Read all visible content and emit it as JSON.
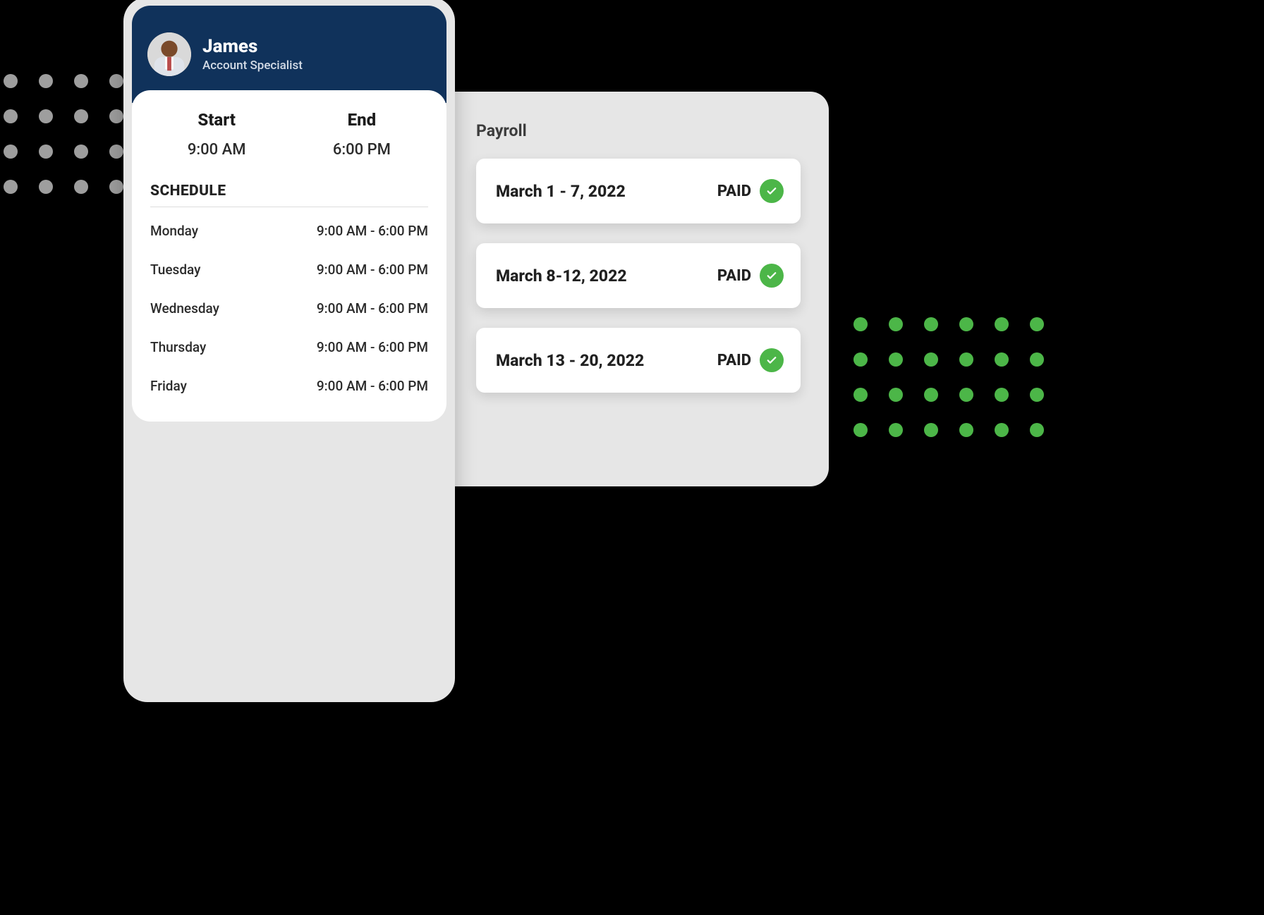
{
  "employee": {
    "name": "James",
    "role": "Account Specialist"
  },
  "times": {
    "start_label": "Start",
    "end_label": "End",
    "start_value": "9:00 AM",
    "end_value": "6:00 PM"
  },
  "schedule": {
    "title": "SCHEDULE",
    "rows": [
      {
        "day": "Monday",
        "hours": "9:00 AM - 6:00 PM"
      },
      {
        "day": "Tuesday",
        "hours": "9:00 AM - 6:00 PM"
      },
      {
        "day": "Wednesday",
        "hours": "9:00 AM - 6:00 PM"
      },
      {
        "day": "Thursday",
        "hours": "9:00 AM - 6:00 PM"
      },
      {
        "day": "Friday",
        "hours": "9:00 AM - 6:00 PM"
      }
    ]
  },
  "payroll": {
    "title": "Payroll",
    "status_label": "PAID",
    "items": [
      {
        "range": "March 1 - 7, 2022"
      },
      {
        "range": "March 8-12, 2022"
      },
      {
        "range": "March 13 - 20, 2022"
      }
    ]
  },
  "colors": {
    "header": "#10325b",
    "accent": "#4cb648"
  }
}
